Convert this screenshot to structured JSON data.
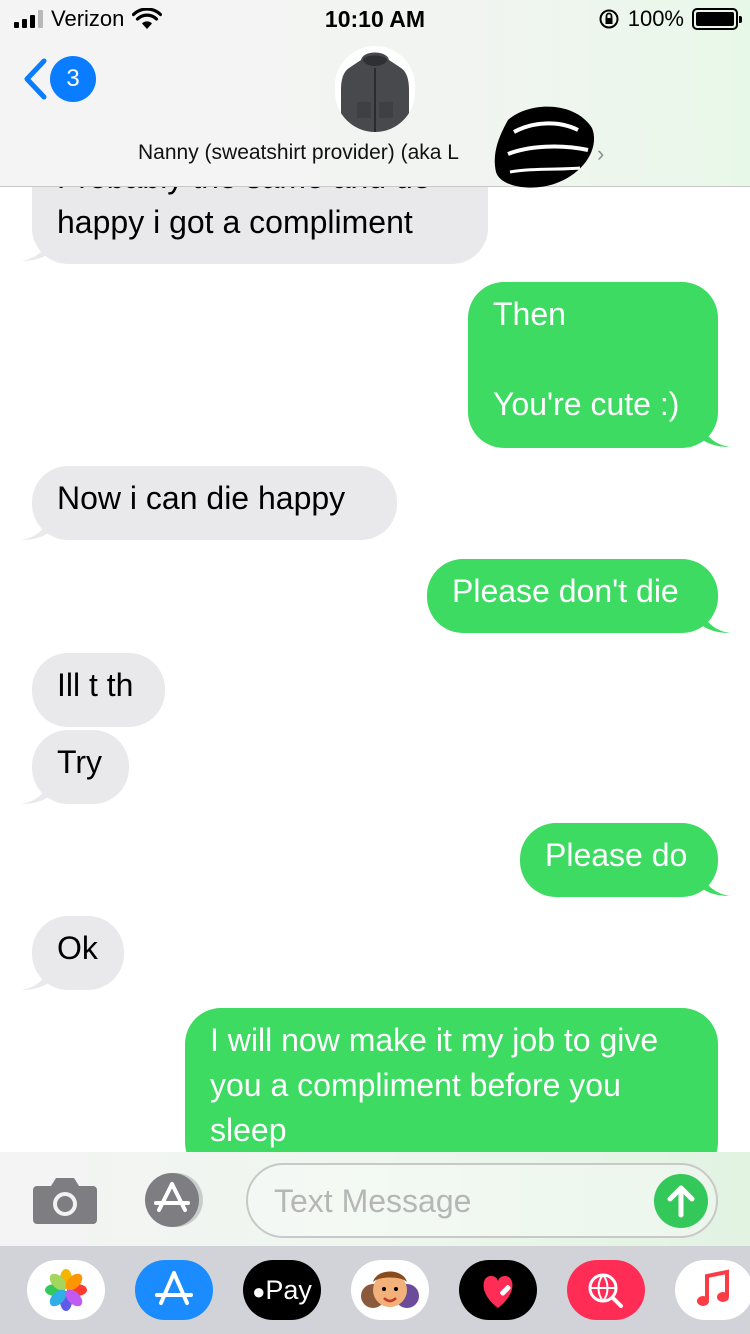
{
  "status_bar": {
    "carrier": "Verizon",
    "time": "10:10 AM",
    "battery_percent": "100%"
  },
  "header": {
    "back_badge_count": "3",
    "contact_name": "Nanny (sweatshirt provider) (aka L"
  },
  "messages": [
    {
      "id": "m0",
      "direction": "incoming",
      "lines": [
        "Probably the same and de",
        "happy i got a compliment"
      ]
    },
    {
      "id": "m1",
      "direction": "outgoing",
      "lines": [
        "Then",
        "",
        "You're cute :)"
      ]
    },
    {
      "id": "m2",
      "direction": "incoming",
      "lines": [
        "Now i can die happy"
      ]
    },
    {
      "id": "m3",
      "direction": "outgoing",
      "lines": [
        "Please don't die"
      ]
    },
    {
      "id": "m4",
      "direction": "incoming",
      "lines": [
        "Ill t th"
      ]
    },
    {
      "id": "m5",
      "direction": "incoming",
      "lines": [
        "Try"
      ]
    },
    {
      "id": "m6",
      "direction": "outgoing",
      "lines": [
        "Please do"
      ]
    },
    {
      "id": "m7",
      "direction": "incoming",
      "lines": [
        "Ok"
      ]
    },
    {
      "id": "m8",
      "direction": "outgoing",
      "lines": [
        "I will now make it my job to give",
        "you a compliment before you",
        "sleep"
      ]
    }
  ],
  "input": {
    "placeholder": "Text Message"
  },
  "app_drawer": {
    "apps": [
      {
        "name": "photos-app-icon"
      },
      {
        "name": "app-store-app-icon"
      },
      {
        "name": "apple-pay-app-icon",
        "label": "Pay"
      },
      {
        "name": "memoji-app-icon"
      },
      {
        "name": "digital-touch-app-icon"
      },
      {
        "name": "web-search-app-icon"
      },
      {
        "name": "music-app-icon"
      }
    ]
  },
  "colors": {
    "outgoing_bubble": "#3ddb62",
    "incoming_bubble": "#e9e9eb",
    "accent_blue": "#0a7cff",
    "send_button": "#34c759"
  }
}
